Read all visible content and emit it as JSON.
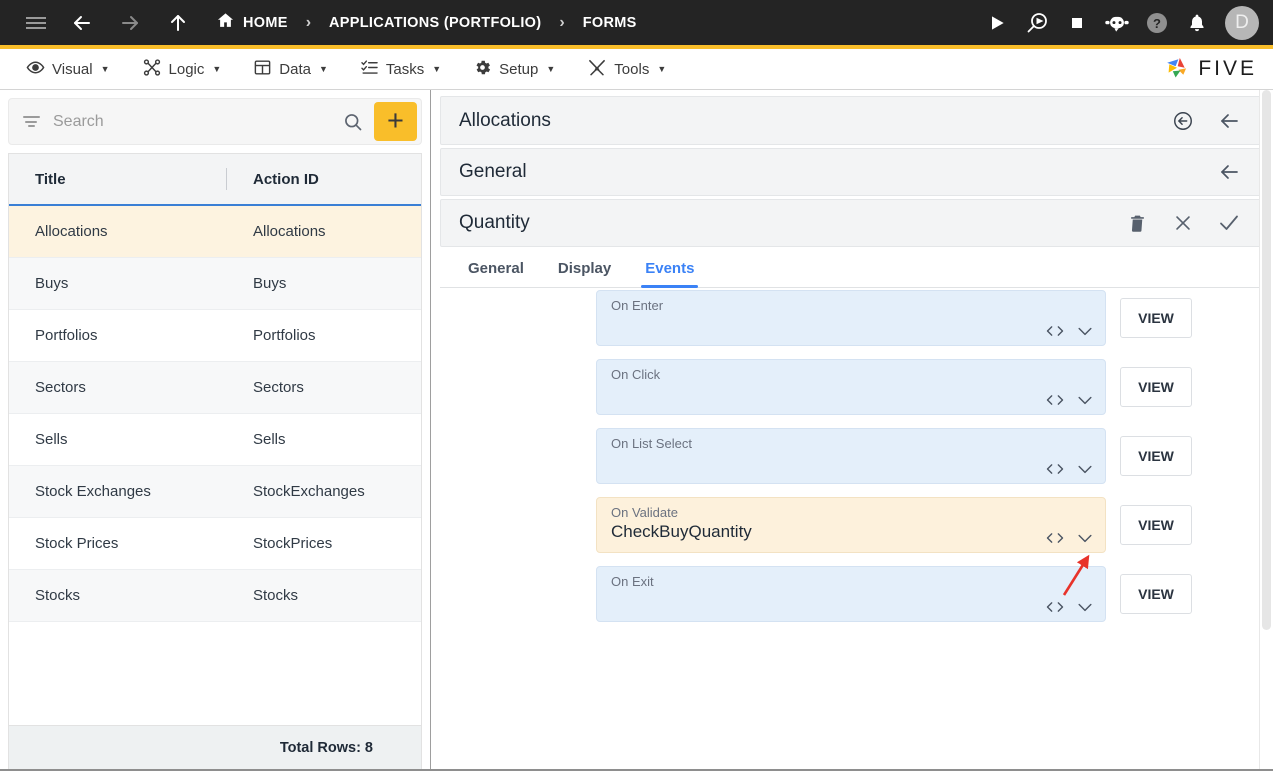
{
  "topbar": {
    "menu_icon": "hamburger-icon",
    "back_icon": "arrow-left-icon",
    "forward_icon": "arrow-right-icon",
    "up_icon": "arrow-up-icon",
    "breadcrumb": [
      {
        "label": "HOME",
        "icon": "home-icon"
      },
      {
        "label": "APPLICATIONS (PORTFOLIO)",
        "icon": ""
      },
      {
        "label": "FORMS",
        "icon": ""
      }
    ],
    "separator": "›",
    "actions": [
      {
        "name": "run-icon",
        "glyph": "play"
      },
      {
        "name": "debug-icon",
        "glyph": "magnifier-play"
      },
      {
        "name": "stop-icon",
        "glyph": "square"
      },
      {
        "name": "chatbot-icon",
        "glyph": "robot"
      },
      {
        "name": "help-icon",
        "glyph": "question"
      },
      {
        "name": "notifications-icon",
        "glyph": "bell"
      }
    ],
    "avatar_initial": "D"
  },
  "menubar": {
    "items": [
      {
        "label": "Visual",
        "icon": "eye-icon"
      },
      {
        "label": "Logic",
        "icon": "nodes-icon"
      },
      {
        "label": "Data",
        "icon": "grid-icon"
      },
      {
        "label": "Tasks",
        "icon": "checklist-icon"
      },
      {
        "label": "Setup",
        "icon": "gear-icon"
      },
      {
        "label": "Tools",
        "icon": "tools-icon"
      }
    ],
    "caret": "▼",
    "brand": "FIVE"
  },
  "left": {
    "search": {
      "placeholder": "Search",
      "value": ""
    },
    "add_label": "+",
    "columns": [
      "Title",
      "Action ID"
    ],
    "rows": [
      {
        "title": "Allocations",
        "action_id": "Allocations"
      },
      {
        "title": "Buys",
        "action_id": "Buys"
      },
      {
        "title": "Portfolios",
        "action_id": "Portfolios"
      },
      {
        "title": "Sectors",
        "action_id": "Sectors"
      },
      {
        "title": "Sells",
        "action_id": "Sells"
      },
      {
        "title": "Stock Exchanges",
        "action_id": "StockExchanges"
      },
      {
        "title": "Stock Prices",
        "action_id": "StockPrices"
      },
      {
        "title": "Stocks",
        "action_id": "Stocks"
      }
    ],
    "selected_index": 0,
    "total_rows": "Total Rows: 8"
  },
  "right": {
    "bars": [
      {
        "title": "Allocations",
        "actions": [
          "back-circle-icon",
          "arrow-left-icon"
        ]
      },
      {
        "title": "General",
        "actions": [
          "arrow-left-icon"
        ]
      },
      {
        "title": "Quantity",
        "actions": [
          "delete-icon",
          "close-icon",
          "confirm-icon"
        ]
      }
    ],
    "tabs": [
      {
        "label": "General",
        "active": false
      },
      {
        "label": "Display",
        "active": false
      },
      {
        "label": "Events",
        "active": true
      }
    ],
    "view_label": "VIEW",
    "events": [
      {
        "label": "On Enter",
        "value": "",
        "highlight": false
      },
      {
        "label": "On Click",
        "value": "",
        "highlight": false
      },
      {
        "label": "On List Select",
        "value": "",
        "highlight": false
      },
      {
        "label": "On Validate",
        "value": "CheckBuyQuantity",
        "highlight": true
      },
      {
        "label": "On Exit",
        "value": "",
        "highlight": false
      }
    ]
  },
  "colors": {
    "accent_yellow": "#f9be2a",
    "topbar_dark": "#242424",
    "tab_active_blue": "#3b82f6",
    "field_blue": "#e4effa",
    "highlight_cream": "#fdf1dc",
    "annotation_red": "#e8332a"
  }
}
